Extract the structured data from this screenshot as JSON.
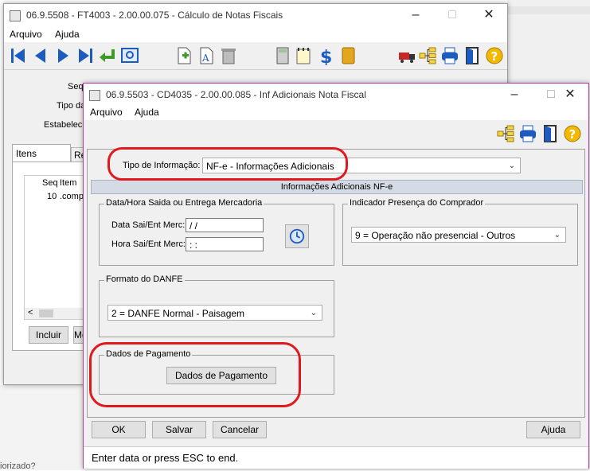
{
  "back_window": {
    "title": "06.9.5508 - FT4003 - 2.00.00.075 - Cálculo de Notas Fiscais",
    "menu": [
      "Arquivo",
      "Ajuda"
    ],
    "toolbar_icons": [
      "first-record-icon",
      "previous-record-icon",
      "next-record-icon",
      "last-record-icon",
      "return-icon",
      "zoom-search-icon",
      "new-document-icon",
      "edit-text-icon",
      "trash-icon",
      "calculator-icon",
      "notepad-icon",
      "dollar-icon",
      "book-icon",
      "truck-icon",
      "tree-icon",
      "printer-icon",
      "exit-door-icon",
      "help-icon"
    ],
    "fields": {
      "seq_label": "Sequ",
      "tipo_label": "Tipo da",
      "estab_label": "Estabelecir"
    },
    "tabs": [
      "Itens",
      "Re"
    ],
    "grid": {
      "headers": [
        "Seq",
        "Item"
      ],
      "rows": [
        [
          "10",
          ".comp"
        ]
      ]
    },
    "buttons": {
      "incluir": "Incluir",
      "mo": "Mo"
    },
    "scroll_left": "<"
  },
  "background": {
    "bottom_text": "iorizado?"
  },
  "dialog": {
    "title": "06.9.5503 - CD4035 - 2.00.00.085 - Inf Adicionais Nota Fiscal",
    "menu": [
      "Arquivo",
      "Ajuda"
    ],
    "toolbar_icons": [
      "tree-icon",
      "printer-icon",
      "exit-door-icon",
      "help-icon"
    ],
    "tipo_label": "Tipo de Informação:",
    "tipo_value": "NF-e - Informações Adicionais",
    "section_title": "Informações Adicionais NF-e",
    "data_hora_group": {
      "title": "Data/Hora Saida ou Entrega Mercadoria",
      "data_label": "Data Sai/Ent Merc:",
      "data_value": " / /",
      "hora_label": "Hora Sai/Ent Merc:",
      "hora_value": " : :"
    },
    "indicador_group": {
      "title": "Indicador Presença do Comprador",
      "value": "9 = Operação não presencial - Outros"
    },
    "formato_group": {
      "title": "Formato do DANFE",
      "value": "2 = DANFE Normal - Paisagem"
    },
    "pagamento_group": {
      "title": "Dados de Pagamento",
      "button": "Dados de Pagamento"
    },
    "buttons": {
      "ok": "OK",
      "salvar": "Salvar",
      "cancelar": "Cancelar",
      "ajuda": "Ajuda"
    },
    "status": "Enter data or press ESC to end."
  },
  "colors": {
    "highlight": "#e0191e",
    "section_header": "#d5dbe5",
    "icon_blue": "#1e5bbf"
  }
}
